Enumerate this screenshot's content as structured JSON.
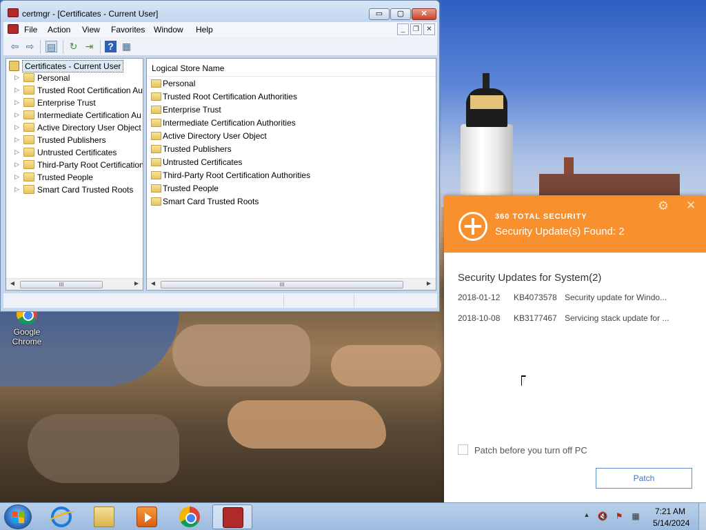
{
  "mmc": {
    "title": "certmgr - [Certificates - Current User]",
    "caption_buttons": {
      "minimize": "▭",
      "maximize": "▢",
      "close": "✕"
    },
    "menus": [
      "File",
      "Action",
      "View",
      "Favorites",
      "Window",
      "Help"
    ],
    "mdi_buttons": {
      "minimize": "_",
      "restore": "❐",
      "close": "✕"
    },
    "toolbar_icons": [
      "back-icon",
      "forward-icon",
      "show-hide-tree-icon",
      "refresh-icon",
      "export-list-icon",
      "help-icon",
      "properties-icon"
    ],
    "tree": {
      "root": "Certificates - Current User",
      "items": [
        "Personal",
        "Trusted Root Certification Au",
        "Enterprise Trust",
        "Intermediate Certification Au",
        "Active Directory User Object",
        "Trusted Publishers",
        "Untrusted Certificates",
        "Third-Party Root Certification",
        "Trusted People",
        "Smart Card Trusted Roots"
      ]
    },
    "list": {
      "column_header": "Logical Store Name",
      "items": [
        "Personal",
        "Trusted Root Certification Authorities",
        "Enterprise Trust",
        "Intermediate Certification Authorities",
        "Active Directory User Object",
        "Trusted Publishers",
        "Untrusted Certificates",
        "Third-Party Root Certification Authorities",
        "Trusted People",
        "Smart Card Trusted Roots"
      ]
    },
    "scroll": {
      "left": "◀",
      "right": "▶",
      "grip": "III"
    }
  },
  "desktop": {
    "icons": [
      {
        "label": "Google Chrome",
        "icon": "chrome-icon"
      }
    ]
  },
  "security_popup": {
    "brand": "360 TOTAL SECURITY",
    "headline": "Security Update(s) Found: 2",
    "section_title": "Security Updates for System(2)",
    "updates": [
      {
        "date": "2018-01-12",
        "kb": "KB4073578",
        "description": "Security update for Windo..."
      },
      {
        "date": "2018-10-08",
        "kb": "KB3177467",
        "description": "Servicing stack update for ..."
      }
    ],
    "patch_option_label": "Patch before you turn off PC",
    "patch_option_checked": false,
    "patch_button": "Patch",
    "gear_glyph": "⚙",
    "close_glyph": "✕",
    "accent_color": "#f7902d"
  },
  "taskbar": {
    "pinned": [
      "start-button",
      "internet-explorer",
      "windows-explorer",
      "media-player",
      "google-chrome",
      "certmgr"
    ],
    "tray_icons": [
      "show-hidden-icons",
      "volume-muted-icon",
      "action-center-icon",
      "network-icon"
    ],
    "tray_glyphs": [
      "▲",
      "🔇",
      "⚑",
      "▦"
    ],
    "clock": {
      "time": "7:21 AM",
      "date": "5/14/2024"
    }
  }
}
